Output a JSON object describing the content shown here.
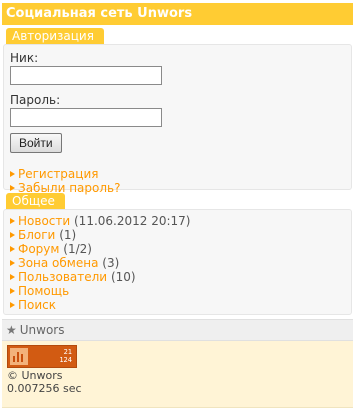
{
  "header": {
    "title": "Социальная сеть Unwors"
  },
  "auth": {
    "section_title": "Авторизация",
    "nick_label": "Ник:",
    "nick_value": "",
    "password_label": "Пароль:",
    "password_value": "",
    "submit_label": "Войти",
    "links": [
      {
        "label": "Регистрация",
        "icon": "arrow-right-icon"
      },
      {
        "label": "Забыли пароль?",
        "icon": "arrow-right-icon"
      }
    ]
  },
  "general": {
    "section_title": "Общее",
    "items": [
      {
        "label": "Новости",
        "extra": "(11.06.2012 20:17)"
      },
      {
        "label": "Блоги",
        "extra": "(1)"
      },
      {
        "label": "Форум",
        "extra": "(1/2)"
      },
      {
        "label": "Зона обмена",
        "extra": "(3)"
      },
      {
        "label": "Пользователи",
        "extra": "(10)"
      },
      {
        "label": "Помощь",
        "extra": ""
      },
      {
        "label": "Поиск",
        "extra": ""
      }
    ]
  },
  "footer": {
    "site_label": "Unwors",
    "counter_values": [
      "21",
      "124"
    ],
    "copyright": "© Unwors",
    "gen_time": "0.007256 sec"
  },
  "colors": {
    "accent": "#ffcc33",
    "link": "#ff9900",
    "footer_bg": "#fff4d6"
  }
}
